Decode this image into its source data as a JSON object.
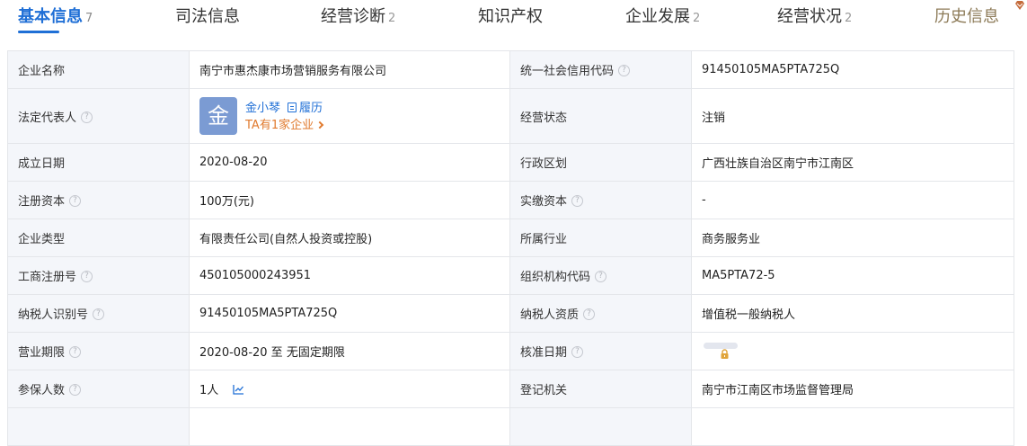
{
  "tabs": [
    {
      "label": "基本信息",
      "count": "7"
    },
    {
      "label": "司法信息",
      "count": ""
    },
    {
      "label": "经营诊断",
      "count": "2"
    },
    {
      "label": "知识产权",
      "count": ""
    },
    {
      "label": "企业发展",
      "count": "2"
    },
    {
      "label": "经营状况",
      "count": "2"
    },
    {
      "label": "历史信息",
      "count": ""
    }
  ],
  "colors": {
    "accent": "#1f6fd6",
    "orange": "#e07a2e",
    "label_bg": "#f4f6fa",
    "history_tab": "#8c7a57"
  },
  "info": {
    "company_name_label": "企业名称",
    "company_name": "南宁市惠杰康市场营销服务有限公司",
    "credit_code_label": "统一社会信用代码",
    "credit_code": "91450105MA5PTA725Q",
    "legal_rep_label": "法定代表人",
    "legal_rep": {
      "avatar_char": "金",
      "name": "金小琴",
      "resume_label": "履历",
      "companies_text": "TA有1家企业"
    },
    "status_label": "经营状态",
    "status": "注销",
    "founded_label": "成立日期",
    "founded": "2020-08-20",
    "region_label": "行政区划",
    "region": "广西壮族自治区南宁市江南区",
    "reg_capital_label": "注册资本",
    "reg_capital": "100万(元)",
    "paid_capital_label": "实缴资本",
    "paid_capital": "-",
    "type_label": "企业类型",
    "type": "有限责任公司(自然人投资或控股)",
    "industry_label": "所属行业",
    "industry": "商务服务业",
    "reg_no_label": "工商注册号",
    "reg_no": "450105000243951",
    "org_code_label": "组织机构代码",
    "org_code": "MA5PTA72-5",
    "taxpayer_id_label": "纳税人识别号",
    "taxpayer_id": "91450105MA5PTA725Q",
    "taxpayer_qual_label": "纳税人资质",
    "taxpayer_qual": "增值税一般纳税人",
    "term_label": "营业期限",
    "term": "2020-08-20 至 无固定期限",
    "approval_label": "核准日期",
    "insured_label": "参保人数",
    "insured": "1人",
    "authority_label": "登记机关",
    "authority": "南宁市江南区市场监督管理局"
  },
  "icons": {
    "help": "question-circle-icon",
    "lock": "lock-icon",
    "trend": "trend-chart-icon",
    "resume": "document-icon",
    "corner": "diamond-icon"
  }
}
